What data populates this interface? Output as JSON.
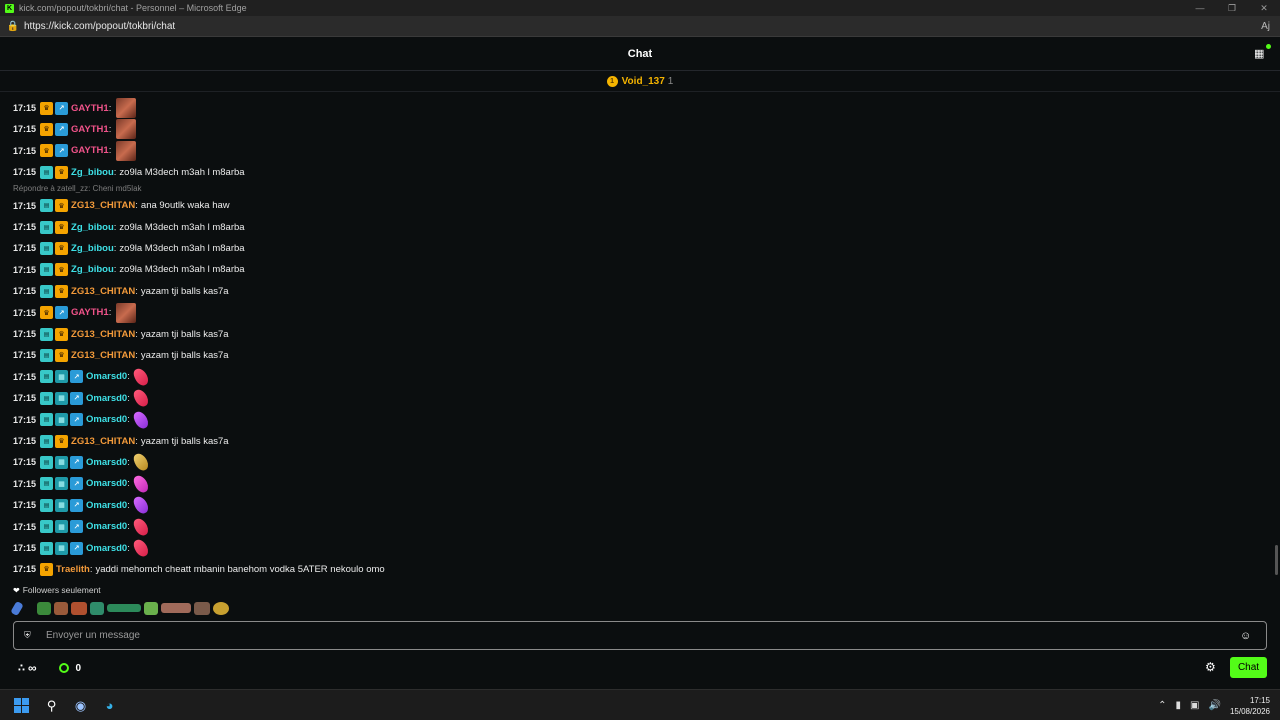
{
  "window": {
    "title": "kick.com/popout/tokbri/chat - Personnel – Microsoft Edge",
    "url": "https://kick.com/popout/tokbri/chat"
  },
  "header": {
    "title": "Chat"
  },
  "pinned": {
    "user": "Void_137",
    "count": "1",
    "badge": "1"
  },
  "messages": [
    {
      "time": "17:15",
      "user": "GAYTH1",
      "color": "#f0538a",
      "text": "",
      "emote": "face"
    },
    {
      "time": "17:15",
      "user": "GAYTH1",
      "color": "#f0538a",
      "text": "",
      "emote": "face"
    },
    {
      "time": "17:15",
      "user": "GAYTH1",
      "color": "#f0538a",
      "text": "",
      "emote": "face"
    },
    {
      "time": "17:15",
      "user": "Zg_bibou",
      "color": "#3ee0e6",
      "text": "zo9la M3dech m3ah l m8arba"
    },
    {
      "time": "17:15",
      "user": "ZG13_CHITAN",
      "color": "#f39a3a",
      "text": "ana 9outlk waka haw"
    },
    {
      "time": "17:15",
      "user": "Zg_bibou",
      "color": "#3ee0e6",
      "text": "zo9la M3dech m3ah l m8arba"
    },
    {
      "time": "17:15",
      "user": "Zg_bibou",
      "color": "#3ee0e6",
      "text": "zo9la M3dech m3ah l m8arba"
    },
    {
      "time": "17:15",
      "user": "Zg_bibou",
      "color": "#3ee0e6",
      "text": "zo9la M3dech m3ah l m8arba"
    },
    {
      "time": "17:15",
      "user": "ZG13_CHITAN",
      "color": "#f39a3a",
      "text": "yazam tji balls kas7a"
    },
    {
      "time": "17:15",
      "user": "GAYTH1",
      "color": "#f0538a",
      "text": "",
      "emote": "face"
    },
    {
      "time": "17:15",
      "user": "ZG13_CHITAN",
      "color": "#f39a3a",
      "text": "yazam tji balls kas7a"
    },
    {
      "time": "17:15",
      "user": "ZG13_CHITAN",
      "color": "#f39a3a",
      "text": "yazam tji balls kas7a"
    },
    {
      "time": "17:15",
      "user": "Omarsd0",
      "color": "#3ee0e6",
      "text": "",
      "emote": "candy-red"
    },
    {
      "time": "17:15",
      "user": "Omarsd0",
      "color": "#3ee0e6",
      "text": "",
      "emote": "candy-red"
    },
    {
      "time": "17:15",
      "user": "Omarsd0",
      "color": "#3ee0e6",
      "text": "",
      "emote": "candy-purple"
    },
    {
      "time": "17:15",
      "user": "ZG13_CHITAN",
      "color": "#f39a3a",
      "text": "yazam tji balls kas7a"
    },
    {
      "time": "17:15",
      "user": "Omarsd0",
      "color": "#3ee0e6",
      "text": "",
      "emote": "candy-gold"
    },
    {
      "time": "17:15",
      "user": "Omarsd0",
      "color": "#3ee0e6",
      "text": "",
      "emote": "candy-magenta"
    },
    {
      "time": "17:15",
      "user": "Omarsd0",
      "color": "#3ee0e6",
      "text": "",
      "emote": "candy-purple"
    },
    {
      "time": "17:15",
      "user": "Omarsd0",
      "color": "#3ee0e6",
      "text": "",
      "emote": "candy-red"
    },
    {
      "time": "17:15",
      "user": "Omarsd0",
      "color": "#3ee0e6",
      "text": "",
      "emote": "candy-red"
    },
    {
      "time": "17:15",
      "user": "Traelith",
      "color": "#f39a3a",
      "text": "yaddi mehomch cheatt mbanin banehom vodka 5ATER nekoulo omo"
    }
  ],
  "reply": {
    "text": "Répondre à zatell_zz: Cheni md5lak"
  },
  "followers_label": "Followers seulement",
  "input": {
    "placeholder": "Envoyer un message"
  },
  "footer": {
    "infinity": "∞",
    "points": "0",
    "send_label": "Chat"
  },
  "taskbar": {
    "time": "17:15",
    "date": "15/08/2026"
  },
  "colors": {
    "accent": "#53fc18",
    "crown": "#f5a400"
  }
}
